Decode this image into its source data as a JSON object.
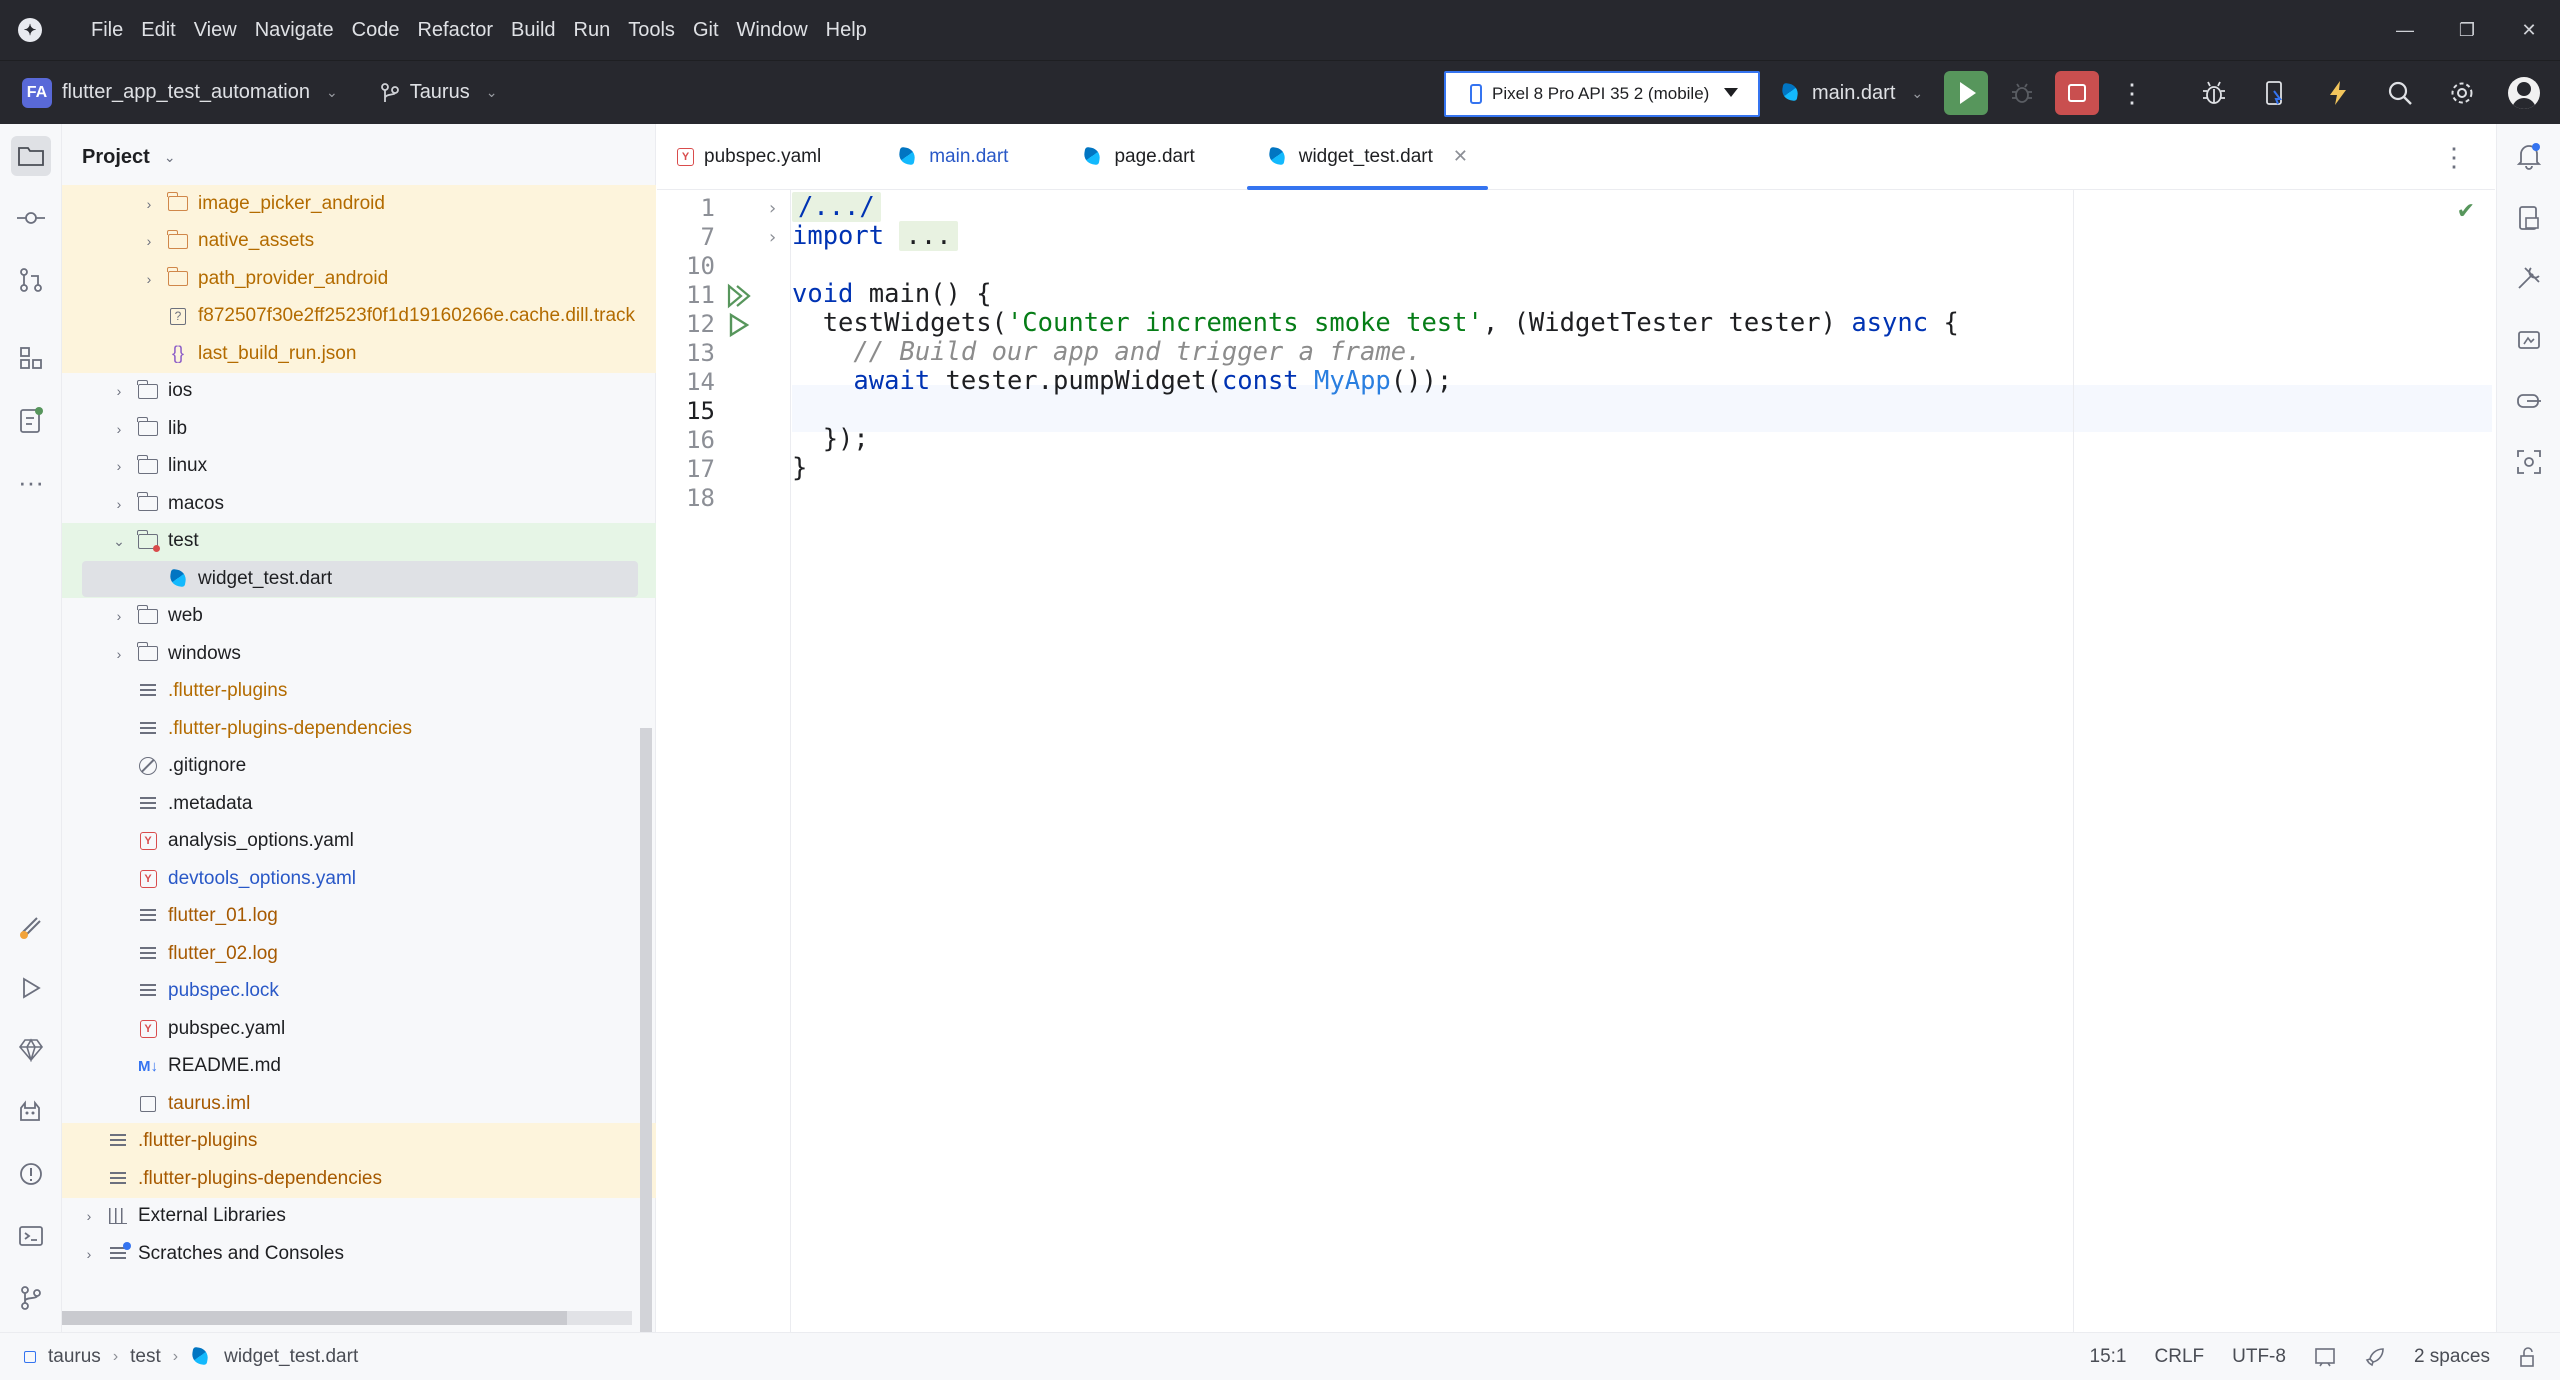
{
  "menubar": {
    "items": [
      "File",
      "Edit",
      "View",
      "Navigate",
      "Code",
      "Refactor",
      "Build",
      "Run",
      "Tools",
      "Git",
      "Window",
      "Help"
    ]
  },
  "toolbar": {
    "project_initials": "FA",
    "project_name": "flutter_app_test_automation",
    "branch": "Taurus",
    "device": "Pixel 8 Pro API 35 2 (mobile)",
    "run_config": "main.dart"
  },
  "project_panel": {
    "title": "Project",
    "rows": [
      {
        "label": "image_picker_android",
        "icon": "folder-orange"
      },
      {
        "label": "native_assets",
        "icon": "folder-orange"
      },
      {
        "label": "path_provider_android",
        "icon": "folder-orange"
      },
      {
        "label": "f872507f30e2ff2523f0f1d19160266e.cache.dill.track",
        "icon": "unknown-file"
      },
      {
        "label": "last_build_run.json",
        "icon": "json-file"
      },
      {
        "label": "ios",
        "icon": "folder"
      },
      {
        "label": "lib",
        "icon": "folder"
      },
      {
        "label": "linux",
        "icon": "folder"
      },
      {
        "label": "macos",
        "icon": "folder"
      },
      {
        "label": "test",
        "icon": "test-folder"
      },
      {
        "label": "widget_test.dart",
        "icon": "dart-file"
      },
      {
        "label": "web",
        "icon": "folder"
      },
      {
        "label": "windows",
        "icon": "folder"
      },
      {
        "label": ".flutter-plugins",
        "icon": "text-file"
      },
      {
        "label": ".flutter-plugins-dependencies",
        "icon": "text-file"
      },
      {
        "label": ".gitignore",
        "icon": "ignore-file"
      },
      {
        "label": ".metadata",
        "icon": "text-file"
      },
      {
        "label": "analysis_options.yaml",
        "icon": "yaml-file"
      },
      {
        "label": "devtools_options.yaml",
        "icon": "yaml-file"
      },
      {
        "label": "flutter_01.log",
        "icon": "text-file"
      },
      {
        "label": "flutter_02.log",
        "icon": "text-file"
      },
      {
        "label": "pubspec.lock",
        "icon": "text-file"
      },
      {
        "label": "pubspec.yaml",
        "icon": "yaml-file"
      },
      {
        "label": "README.md",
        "icon": "markdown-file"
      },
      {
        "label": "taurus.iml",
        "icon": "iml-file"
      },
      {
        "label": ".flutter-plugins",
        "icon": "text-file"
      },
      {
        "label": ".flutter-plugins-dependencies",
        "icon": "text-file"
      },
      {
        "label": "External Libraries",
        "icon": "library"
      },
      {
        "label": "Scratches and Consoles",
        "icon": "scratches"
      }
    ]
  },
  "editor": {
    "tabs": [
      {
        "label": "pubspec.yaml",
        "icon": "yaml-file"
      },
      {
        "label": "main.dart",
        "icon": "dart-file"
      },
      {
        "label": "page.dart",
        "icon": "dart-file"
      },
      {
        "label": "widget_test.dart",
        "icon": "dart-file",
        "active": true
      }
    ],
    "line_numbers": [
      "1",
      "7",
      "10",
      "11",
      "12",
      "13",
      "14",
      "15",
      "16",
      "17",
      "18"
    ],
    "code": {
      "l1": "/.../",
      "l7_kw": "import",
      "l7_folded": "...",
      "l11_kw": "void",
      "l11_rest": " main() {",
      "l12_a": "  testWidgets(",
      "l12_str": "'Counter increments smoke test'",
      "l12_b": ", (WidgetTester tester) ",
      "l12_kw": "async",
      "l12_c": " {",
      "l13": "    // Build our app and trigger a frame.",
      "l14_kw": "await",
      "l14_a": " tester.pumpWidget(",
      "l14_kw2": "const",
      "l14_cls": "MyApp",
      "l14_b": "());",
      "l16": "  });",
      "l17": "}"
    }
  },
  "statusbar": {
    "crumbs": [
      "taurus",
      "test",
      "widget_test.dart"
    ],
    "position": "15:1",
    "line_separator": "CRLF",
    "encoding": "UTF-8",
    "indent": "2 spaces"
  },
  "colors": {
    "accent": "#3574f0",
    "run_green": "#57965c",
    "stop_red": "#c94f4f",
    "keyword": "#0033b3",
    "string": "#067d17"
  }
}
